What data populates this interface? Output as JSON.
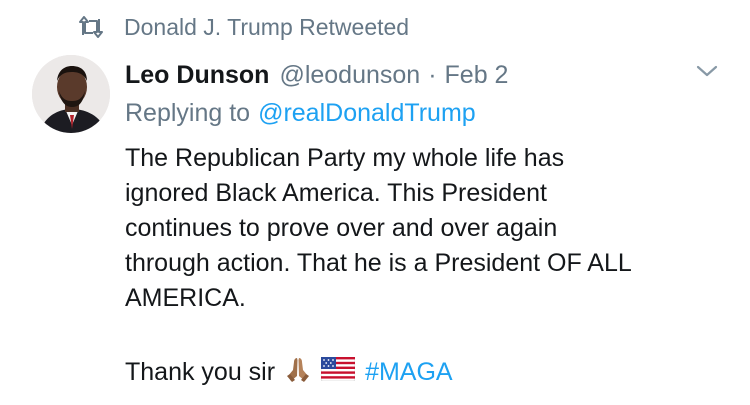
{
  "retweet": {
    "icon": "retweet-icon",
    "label": "Donald J. Trump Retweeted"
  },
  "author": {
    "avatar": "avatar",
    "display_name": "Leo Dunson",
    "handle": "@leodunson",
    "separator": "·",
    "date": "Feb 2"
  },
  "menu": {
    "icon": "chevron-down-icon"
  },
  "reply": {
    "prefix": "Replying to",
    "mention": "@realDonaldTrump"
  },
  "body": {
    "lines": [
      "The Republican Party my whole life has",
      "ignored Black America. This President",
      "continues to prove over and over again",
      "through action. That he is a President OF ALL",
      "AMERICA."
    ],
    "thanks": "Thank you sir",
    "emojis": [
      "folded-hands-emoji",
      "us-flag-emoji"
    ],
    "hashtag": "#MAGA"
  },
  "colors": {
    "text": "#14171a",
    "muted": "#657786",
    "link": "#1da1f2"
  }
}
